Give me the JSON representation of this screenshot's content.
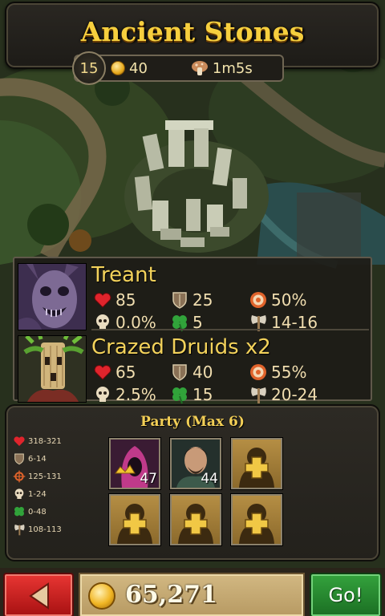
{
  "location": {
    "title": "Ancient Stones",
    "level": "15",
    "gold_cost": "40",
    "duration": "1m5s"
  },
  "enemies": [
    {
      "name": "Treant",
      "health": "85",
      "armor": "25",
      "accuracy": "50%",
      "crit": "0.0%",
      "luck": "5",
      "damage": "14-16",
      "portrait_icon": "treant-portrait"
    },
    {
      "name": "Crazed Druids x2",
      "health": "65",
      "armor": "40",
      "accuracy": "55%",
      "crit": "2.5%",
      "luck": "15",
      "damage": "20-24",
      "portrait_icon": "druid-portrait"
    }
  ],
  "party": {
    "title": "Party (Max 6)",
    "stats": {
      "health": "318-321",
      "armor": "6-14",
      "accuracy": "125-131",
      "crit": "1-24",
      "luck": "0-48",
      "damage": "108-113"
    },
    "members": [
      {
        "level": "47",
        "icon": "hooded-mage-portrait"
      },
      {
        "level": "44",
        "icon": "warrior-portrait"
      }
    ],
    "empty_slots": 4
  },
  "footer": {
    "gold": "65,271",
    "go_label": "Go!"
  },
  "colors": {
    "title_gold": "#f6cf3e",
    "go_green": "#2b8f34",
    "back_red": "#d02424",
    "panel_dark": "#1e1c17"
  }
}
